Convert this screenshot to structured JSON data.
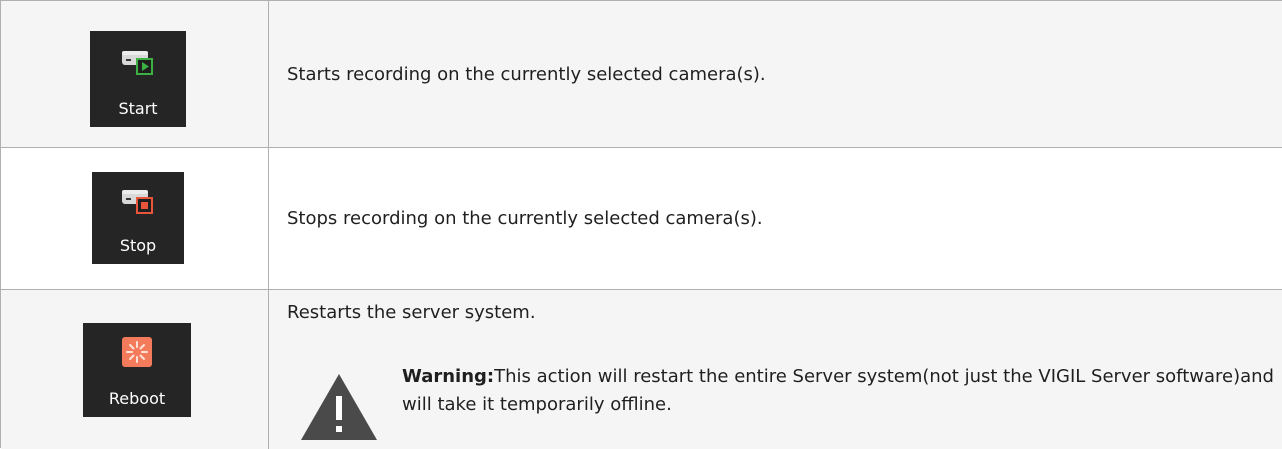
{
  "rows": [
    {
      "button_label": "Start",
      "icon": "server-start-icon",
      "description": "Starts recording on the currently selected camera(s)."
    },
    {
      "button_label": "Stop",
      "icon": "server-stop-icon",
      "description": "Stops recording on the currently selected camera(s)."
    },
    {
      "button_label": "Reboot",
      "icon": "reboot-icon",
      "description": "Restarts the server system.",
      "warning_label": "Warning:",
      "warning_text": "This action will restart the entire Server system(not just the VIGIL Server software)and will take it temporarily offline."
    }
  ],
  "colors": {
    "button_bg": "#252526",
    "start_accent": "#3cb043",
    "stop_accent": "#e8553a",
    "reboot_accent": "#f47a5c",
    "warning_icon": "#4a4a4a"
  }
}
